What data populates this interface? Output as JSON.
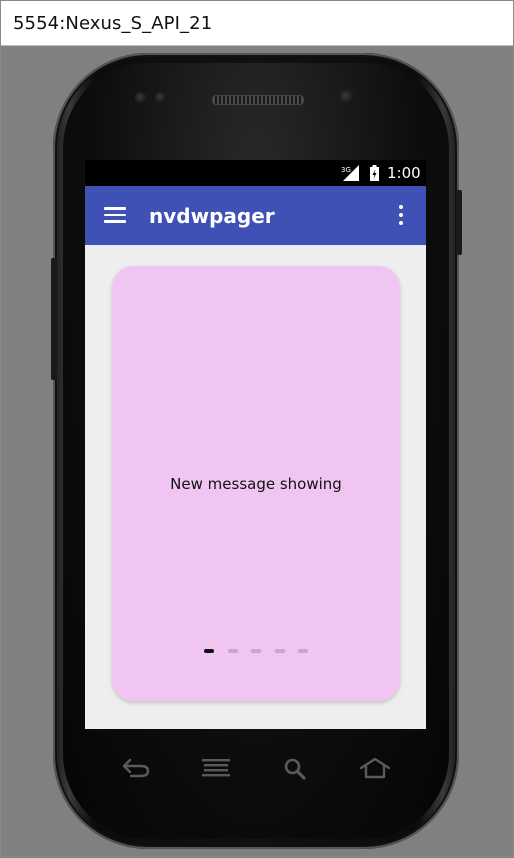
{
  "emulator": {
    "window_title": "5554:Nexus_S_API_21"
  },
  "status_bar": {
    "network_label": "3G",
    "time": "1:00",
    "icons": [
      "signal-icon",
      "battery-icon"
    ]
  },
  "app_bar": {
    "title": "nvdwpager",
    "color": "#3f51b5",
    "left_icon": "hamburger-menu-icon",
    "right_icon": "overflow-menu-icon"
  },
  "pager": {
    "card_color": "#f0c5f1",
    "message": "New message showing",
    "page_count": 5,
    "active_page": 1,
    "active_dot_color": "#111111",
    "inactive_dot_color": "#c7a6c8"
  },
  "nav_buttons": [
    {
      "name": "back-icon"
    },
    {
      "name": "menu-icon"
    },
    {
      "name": "search-icon"
    },
    {
      "name": "home-icon"
    }
  ]
}
